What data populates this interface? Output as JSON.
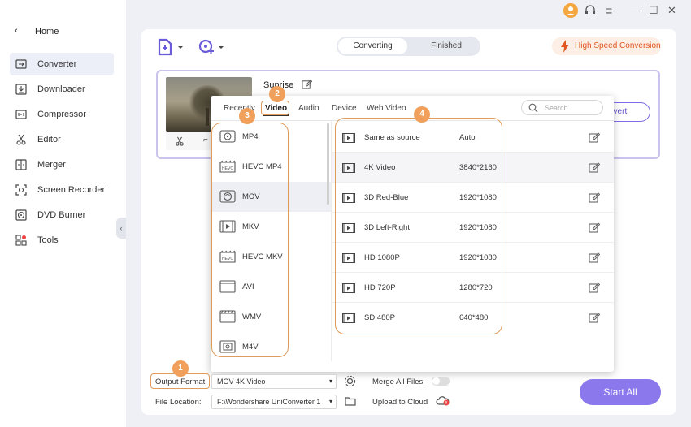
{
  "window": {
    "menu_icon": "hamburger-icon",
    "minimize": "—",
    "maximize": "☐",
    "close": "✕"
  },
  "sidebar": {
    "home_label": "Home",
    "items": [
      {
        "label": "Converter",
        "icon": "converter-icon",
        "active": true
      },
      {
        "label": "Downloader",
        "icon": "downloader-icon"
      },
      {
        "label": "Compressor",
        "icon": "compressor-icon"
      },
      {
        "label": "Editor",
        "icon": "scissors-icon"
      },
      {
        "label": "Merger",
        "icon": "merger-icon"
      },
      {
        "label": "Screen Recorder",
        "icon": "screen-recorder-icon"
      },
      {
        "label": "DVD Burner",
        "icon": "dvd-icon"
      },
      {
        "label": "Tools",
        "icon": "tools-icon"
      }
    ]
  },
  "header": {
    "tabs": [
      "Converting",
      "Finished"
    ],
    "active_tab": "Converting",
    "high_speed_label": "High Speed Conversion"
  },
  "file": {
    "title": "Sunrise",
    "convert_label": "nvert"
  },
  "dropdown": {
    "tabs": [
      "Recently",
      "Video",
      "Audio",
      "Device",
      "Web Video"
    ],
    "active_tab": "Video",
    "search_placeholder": "Search",
    "formats": [
      {
        "label": "MP4",
        "icon": "mp4-icon"
      },
      {
        "label": "HEVC MP4",
        "icon": "hevc-icon"
      },
      {
        "label": "MOV",
        "icon": "mov-icon",
        "selected": true
      },
      {
        "label": "MKV",
        "icon": "mkv-icon"
      },
      {
        "label": "HEVC MKV",
        "icon": "hevc-icon"
      },
      {
        "label": "AVI",
        "icon": "avi-icon"
      },
      {
        "label": "WMV",
        "icon": "wmv-icon"
      },
      {
        "label": "M4V",
        "icon": "m4v-icon"
      }
    ],
    "presets": [
      {
        "name": "Same as source",
        "res": "Auto"
      },
      {
        "name": "4K Video",
        "res": "3840*2160",
        "highlight": true
      },
      {
        "name": "3D Red-Blue",
        "res": "1920*1080"
      },
      {
        "name": "3D Left-Right",
        "res": "1920*1080"
      },
      {
        "name": "HD 1080P",
        "res": "1920*1080"
      },
      {
        "name": "HD 720P",
        "res": "1280*720"
      },
      {
        "name": "SD 480P",
        "res": "640*480"
      }
    ]
  },
  "annotations": [
    "1",
    "2",
    "3",
    "4"
  ],
  "bottom": {
    "output_format_label": "Output Format:",
    "output_format_value": "MOV 4K Video",
    "merge_label": "Merge All Files:",
    "file_location_label": "File Location:",
    "file_location_value": "F:\\Wondershare UniConverter 1",
    "upload_label": "Upload to Cloud",
    "start_all_label": "Start All"
  },
  "colors": {
    "accent": "#8a78ec",
    "annotation": "#f0a05a",
    "high_speed": "#e0561f"
  }
}
